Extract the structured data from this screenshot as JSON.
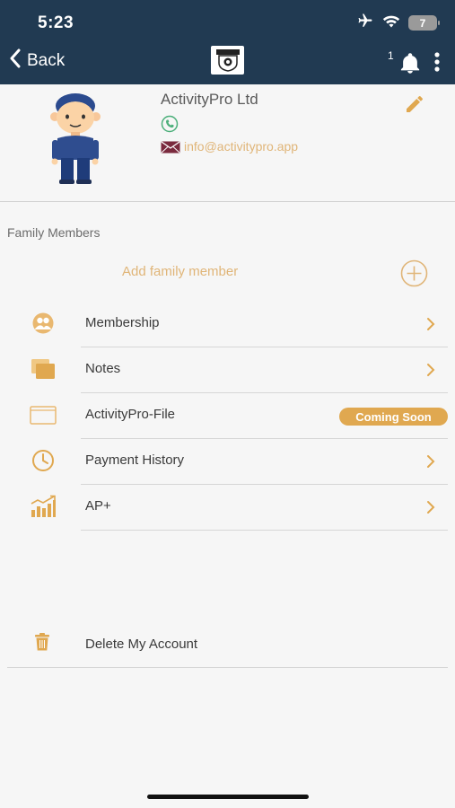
{
  "status_bar": {
    "time": "5:23",
    "battery": "7"
  },
  "header": {
    "back_label": "Back",
    "notification_count": "1"
  },
  "profile": {
    "name": "ActivityPro Ltd",
    "email": "info@activitypro.app"
  },
  "family": {
    "section_title": "Family Members",
    "add_label": "Add family member"
  },
  "menu": {
    "items": [
      {
        "label": "Membership",
        "icon": "people-icon"
      },
      {
        "label": "Notes",
        "icon": "notes-icon"
      },
      {
        "label": "ActivityPro-File",
        "icon": "folder-icon",
        "badge": "Coming Soon"
      },
      {
        "label": "Payment History",
        "icon": "clock-icon"
      },
      {
        "label": "AP+",
        "icon": "growth-chart-icon"
      }
    ]
  },
  "delete": {
    "label": "Delete My Account"
  },
  "colors": {
    "header_bg": "#213a52",
    "accent": "#e0a850",
    "link": "#e0b578",
    "phone_green": "#4caf7a"
  }
}
